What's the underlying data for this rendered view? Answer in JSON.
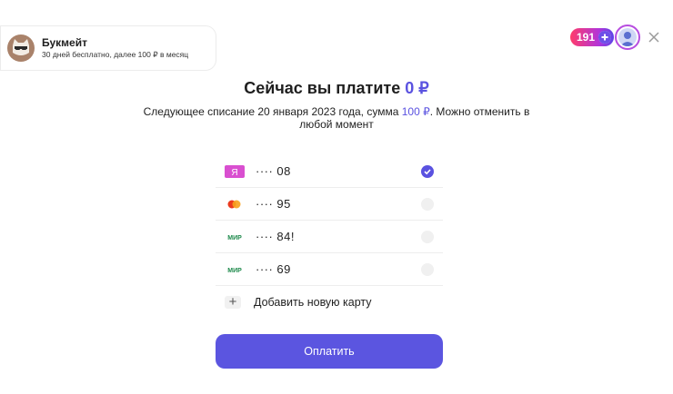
{
  "service": {
    "name": "Букмейт",
    "terms": "30 дней бесплатно, далее 100 ₽ в месяц",
    "logo_icon": "cat-logo-icon"
  },
  "header": {
    "plus_points": "191",
    "avatar_icon": "user-avatar-icon",
    "close_icon": "close-icon"
  },
  "payment": {
    "title_prefix": "Сейчас вы платите ",
    "title_amount": "0 ₽",
    "subtitle_part1": "Следующее списание 20 января 2023 года, сумма ",
    "subtitle_amount": "100 ₽",
    "subtitle_part2": ". Можно отменить в любой момент"
  },
  "cards": [
    {
      "brand": "yandex",
      "brand_label": "Я",
      "number": "···· 08",
      "selected": true
    },
    {
      "brand": "mastercard",
      "brand_label": "",
      "number": "···· 95",
      "selected": false
    },
    {
      "brand": "mir",
      "brand_label": "МИР",
      "number": "···· 84!",
      "selected": false
    },
    {
      "brand": "mir",
      "brand_label": "МИР",
      "number": "···· 69",
      "selected": false
    }
  ],
  "add_card_label": "Добавить новую карту",
  "pay_button_label": "Оплатить",
  "colors": {
    "accent": "#5a52e0",
    "plus_gradient_start": "#ff3c6a",
    "plus_gradient_end": "#5a46e8"
  }
}
